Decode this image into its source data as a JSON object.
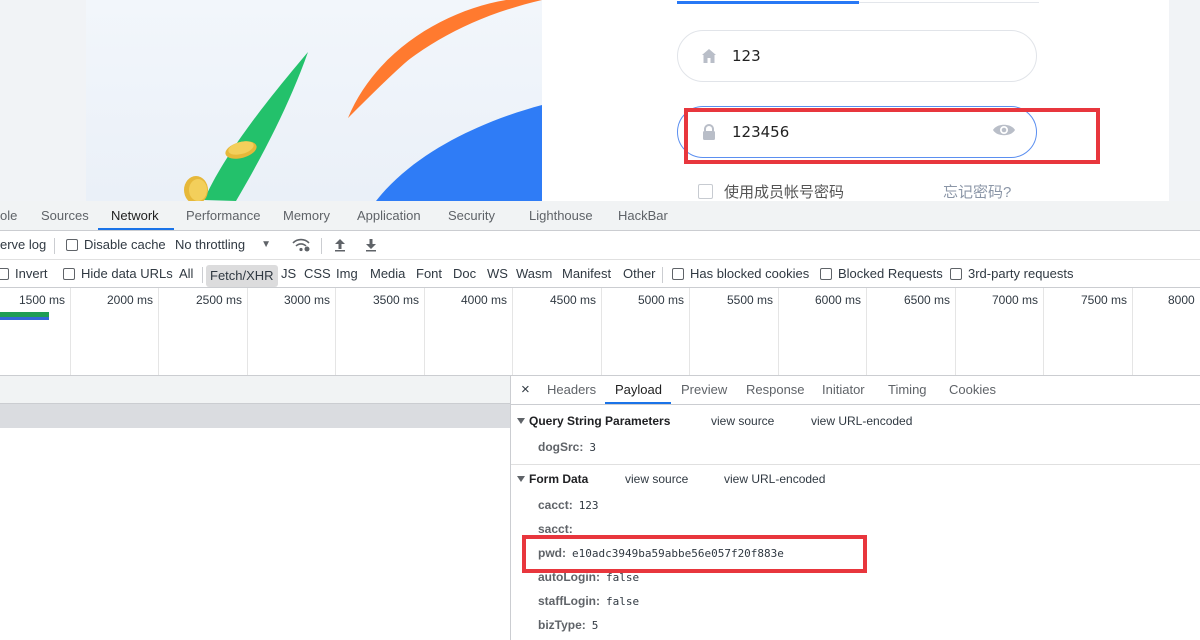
{
  "login": {
    "username_value": "123",
    "password_value": "123456",
    "remember_label": "使用成员帐号密码",
    "forgot_label": "忘记密码?"
  },
  "devtools": {
    "tabs": [
      "ole",
      "Sources",
      "Network",
      "Performance",
      "Memory",
      "Application",
      "Security",
      "Lighthouse",
      "HackBar"
    ],
    "active_tab": "Network",
    "toolbar1": {
      "preserve_log": "erve log",
      "disable_cache": "Disable cache",
      "throttling": "No throttling"
    },
    "toolbar2": {
      "invert": "Invert",
      "hide_data_urls": "Hide data URLs",
      "filters": [
        "All",
        "Fetch/XHR",
        "JS",
        "CSS",
        "Img",
        "Media",
        "Font",
        "Doc",
        "WS",
        "Wasm",
        "Manifest",
        "Other"
      ],
      "active_filter": "Fetch/XHR",
      "has_blocked_cookies": "Has blocked cookies",
      "blocked_requests": "Blocked Requests",
      "third_party": "3rd-party requests"
    },
    "timeline_labels": [
      "1500 ms",
      "2000 ms",
      "2500 ms",
      "3000 ms",
      "3500 ms",
      "4000 ms",
      "4500 ms",
      "5000 ms",
      "5500 ms",
      "6000 ms",
      "6500 ms",
      "7000 ms",
      "7500 ms",
      "8000"
    ],
    "detail_tabs": [
      "Headers",
      "Payload",
      "Preview",
      "Response",
      "Initiator",
      "Timing",
      "Cookies"
    ],
    "active_detail_tab": "Payload",
    "close_glyph": "×",
    "query_section": {
      "title": "Query String Parameters",
      "view_source": "view source",
      "view_url_encoded": "view URL-encoded",
      "params": [
        {
          "key": "dogSrc:",
          "value": "3"
        }
      ]
    },
    "form_section": {
      "title": "Form Data",
      "view_source": "view source",
      "view_url_encoded": "view URL-encoded",
      "params": [
        {
          "key": "cacct:",
          "value": "123"
        },
        {
          "key": "sacct:",
          "value": ""
        },
        {
          "key": "pwd:",
          "value": "e10adc3949ba59abbe56e057f20f883e"
        },
        {
          "key": "autoLogin:",
          "value": "false"
        },
        {
          "key": "staffLogin:",
          "value": "false"
        },
        {
          "key": "bizType:",
          "value": "5"
        }
      ]
    }
  },
  "colors": {
    "highlight_red": "#e8363d",
    "accent_blue": "#1a73e8",
    "illus_orange": "#ff7a2f",
    "illus_blue": "#2f7cf6",
    "illus_green": "#23c16b"
  }
}
